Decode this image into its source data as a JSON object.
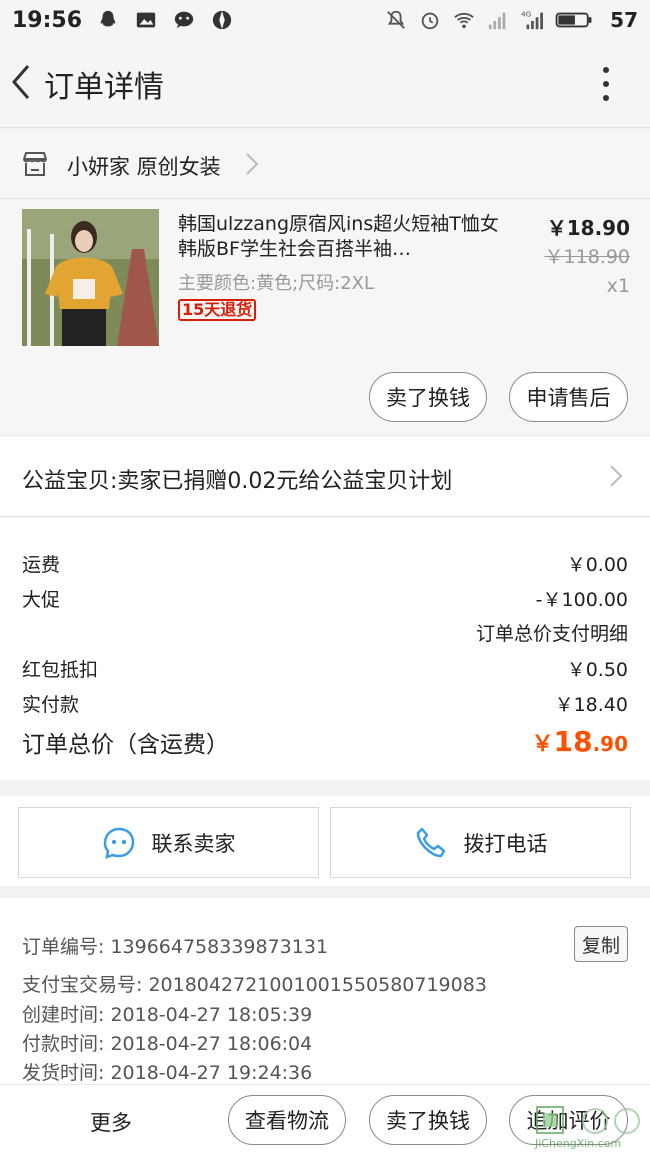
{
  "status_bar": {
    "time": "19:56",
    "battery": "57",
    "network": "4G",
    "icons_left": [
      "qq-icon",
      "image-icon",
      "wechat-icon",
      "photo-app-icon"
    ],
    "icons_right": [
      "mute-icon",
      "alarm-icon",
      "wifi-icon",
      "signal-icon",
      "signal-4g-icon",
      "battery-icon"
    ]
  },
  "navbar": {
    "title": "订单详情"
  },
  "shop": {
    "name": "小妍家 原创女装"
  },
  "item": {
    "title": "韩国ulzzang原宿风ins超火短袖T恤女韩版BF学生社会百搭半袖…",
    "sku": "主要颜色:黄色;尺码:2XL",
    "tag": "15天退货",
    "price": "￥18.90",
    "original_price": "￥118.90",
    "quantity": "x1",
    "buttons": {
      "resell": "卖了换钱",
      "after_sale": "申请售后"
    }
  },
  "charity": {
    "text": "公益宝贝:卖家已捐赠0.02元给公益宝贝计划"
  },
  "fees": {
    "shipping_label": "运费",
    "shipping_value": "￥0.00",
    "promo_label": "大促",
    "promo_value": "-￥100.00",
    "detail_link": "订单总价支付明细",
    "redpacket_label": "红包抵扣",
    "redpacket_value": "￥0.50",
    "paid_label": "实付款",
    "paid_value": "￥18.40",
    "total_label": "订单总价（含运费）",
    "total_currency": "￥",
    "total_integer": "18",
    "total_decimal": ".90"
  },
  "contact": {
    "seller": "联系卖家",
    "call": "拨打电话"
  },
  "order_info": {
    "order_no": "订单编号: 139664758339873131",
    "copy": "复制",
    "alipay_no": "支付宝交易号: 2018042721001001550580719083",
    "created": "创建时间: 2018-04-27 18:05:39",
    "paid": "付款时间: 2018-04-27 18:06:04",
    "shipped": "发货时间: 2018-04-27 19:24:36"
  },
  "bottom_bar": {
    "more": "更多",
    "logistics": "查看物流",
    "resell": "卖了换钱",
    "review": "追加评价"
  },
  "watermark": {
    "text": "JiChengXin.com"
  },
  "colors": {
    "accent": "#ff5000",
    "link_icon": "#3a9ee4",
    "tag_red": "#d81e06"
  }
}
